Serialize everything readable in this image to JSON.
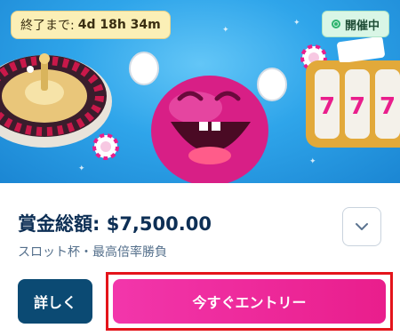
{
  "timer": {
    "label": "終了まで:",
    "value": "4d 18h 34m"
  },
  "status": {
    "label": "開催中",
    "icon": "check-circle-icon",
    "color": "#2fb46f"
  },
  "tournament": {
    "prize_label": "賞金総額: $7,500.00",
    "subtitle": "スロット杯・最高倍率勝負"
  },
  "buttons": {
    "details_label": "詳しく",
    "entry_label": "今すぐエントリー",
    "expand_icon": "chevron-down-icon"
  },
  "colors": {
    "accent": "#e91e8c",
    "primary": "#0b4a73",
    "highlight": "#e4141b"
  }
}
